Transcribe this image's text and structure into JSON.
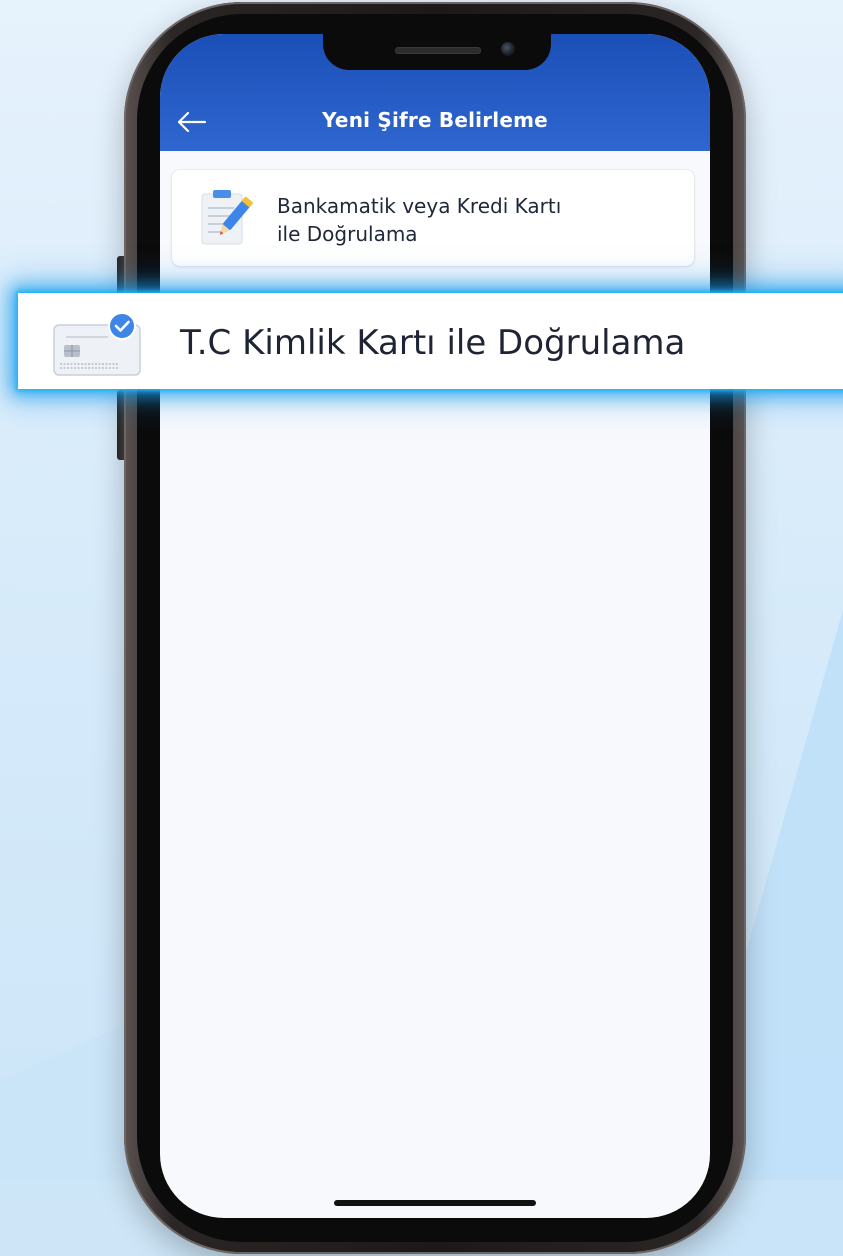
{
  "header": {
    "title": "Yeni Şifre Belirleme",
    "back_icon": "arrow-left-icon"
  },
  "options": [
    {
      "icon": "clipboard-pencil-icon",
      "label_line1": "Bankamatik veya Kredi Kartı",
      "label_line2": "ile Doğrulama"
    },
    {
      "icon": "id-card-check-icon",
      "label": "T.C Kimlik Kartı ile Doğrulama",
      "highlighted": true
    }
  ],
  "colors": {
    "header_blue": "#2559c4",
    "highlight_glow": "#23b4f3",
    "check_badge": "#3d86e8"
  }
}
